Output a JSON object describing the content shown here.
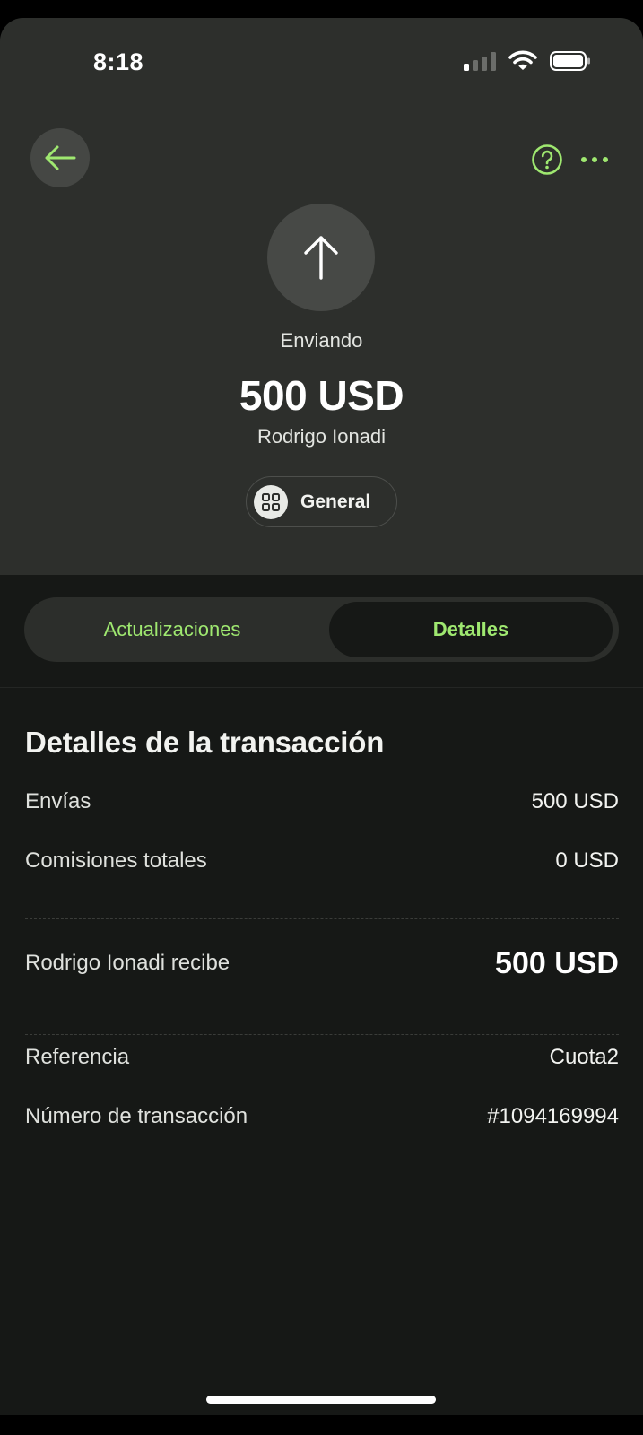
{
  "status_bar": {
    "time": "8:18"
  },
  "header": {
    "back_icon": "arrow-left-icon",
    "help_icon": "question-circle-icon",
    "more_icon": "more-horizontal-icon"
  },
  "summary": {
    "direction_icon": "arrow-up-icon",
    "status": "Enviando",
    "amount": "500 USD",
    "recipient": "Rodrigo Ionadi",
    "category": {
      "icon": "grid-icon",
      "label": "General"
    }
  },
  "tabs": [
    {
      "label": "Actualizaciones",
      "selected": false
    },
    {
      "label": "Detalles",
      "selected": true
    }
  ],
  "details": {
    "title": "Detalles de la transacción",
    "rows": [
      {
        "label": "Envías",
        "value": "500 USD"
      },
      {
        "label": "Comisiones totales",
        "value": "0 USD"
      },
      {
        "label": "Rodrigo Ionadi recibe",
        "value": "500 USD"
      },
      {
        "label": "Referencia",
        "value": "Cuota2"
      },
      {
        "label": "Número de transacción",
        "value": "#1094169994"
      }
    ]
  },
  "colors": {
    "accent": "#9fe870",
    "hero_bg": "#2d2f2c",
    "page_bg": "#161816"
  }
}
